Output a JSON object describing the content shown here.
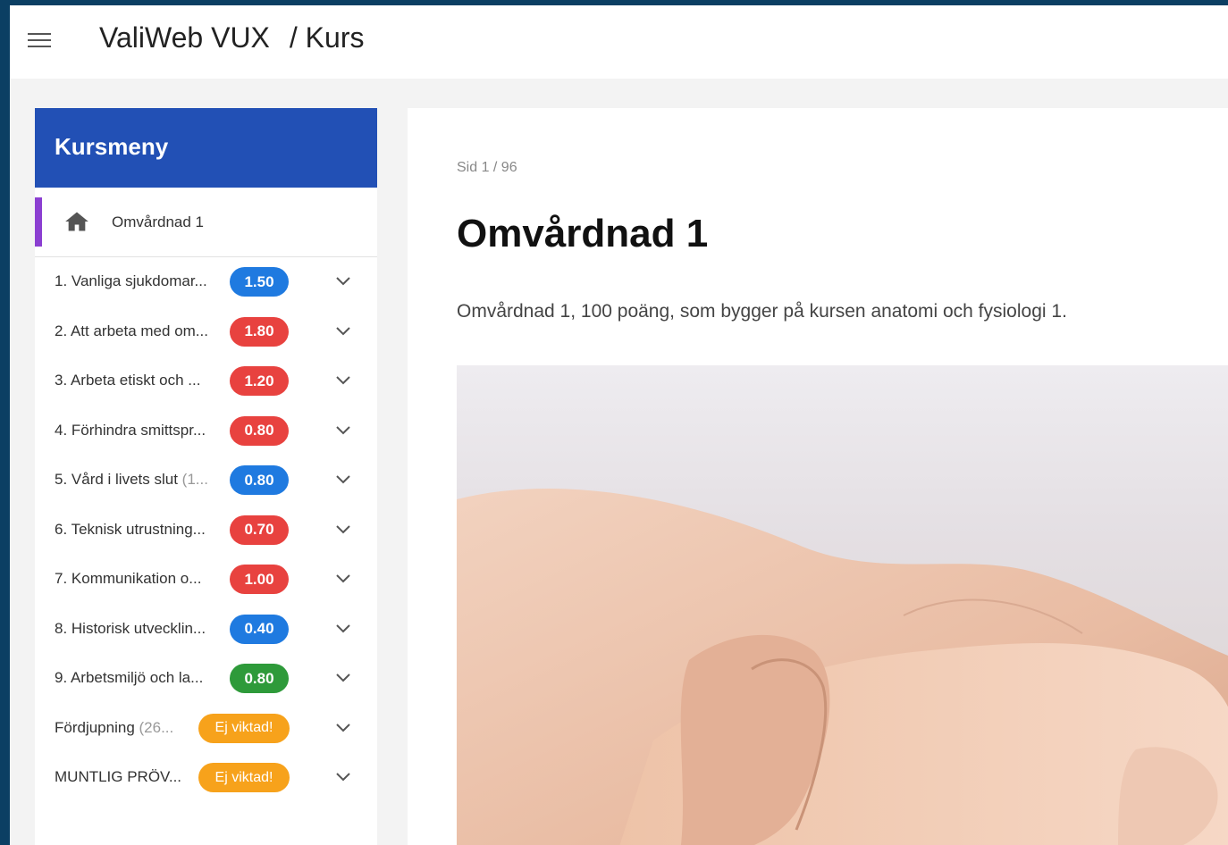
{
  "header": {
    "app_name": "ValiWeb VUX",
    "section": "/ Kurs"
  },
  "sidebar": {
    "title": "Kursmeny",
    "home_label": "Omvårdnad 1",
    "items": [
      {
        "label": "1. Vanliga sjukdomar...",
        "suffix": "",
        "badge": "1.50",
        "badge_color": "#1f7ae0"
      },
      {
        "label": "2. Att arbeta med om...",
        "suffix": "",
        "badge": "1.80",
        "badge_color": "#e8423f"
      },
      {
        "label": "3. Arbeta etiskt och ...",
        "suffix": "",
        "badge": "1.20",
        "badge_color": "#e8423f"
      },
      {
        "label": "4. Förhindra smittspr...",
        "suffix": "",
        "badge": "0.80",
        "badge_color": "#e8423f"
      },
      {
        "label": "5. Vård i livets slut ",
        "suffix": "(1...",
        "badge": "0.80",
        "badge_color": "#1f7ae0"
      },
      {
        "label": "6. Teknisk utrustning...",
        "suffix": "",
        "badge": "0.70",
        "badge_color": "#e8423f"
      },
      {
        "label": "7. Kommunikation o...",
        "suffix": "",
        "badge": "1.00",
        "badge_color": "#e8423f"
      },
      {
        "label": "8. Historisk utvecklin...",
        "suffix": "",
        "badge": "0.40",
        "badge_color": "#1f7ae0"
      },
      {
        "label": "9. Arbetsmiljö och la...",
        "suffix": "",
        "badge": "0.80",
        "badge_color": "#2e9a3a"
      },
      {
        "label": "Fördjupning ",
        "suffix": "(26...",
        "badge": "Ej viktad!",
        "badge_color": "#f7a21b"
      },
      {
        "label": "MUNTLIG PRÖV...",
        "suffix": "",
        "badge": "Ej viktad!",
        "badge_color": "#f7a21b"
      }
    ]
  },
  "main": {
    "page_indicator": "Sid 1 / 96",
    "title": "Omvårdnad 1",
    "description": "Omvårdnad 1, 100 poäng, som bygger på kursen anatomi och fysiologi 1."
  },
  "icons": {
    "menu": "hamburger-icon",
    "home": "home-icon",
    "expand": "chevron-down-icon"
  }
}
